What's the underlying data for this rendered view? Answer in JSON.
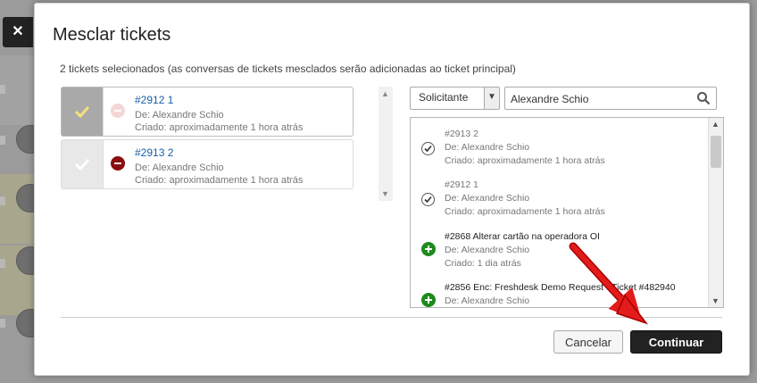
{
  "modal": {
    "close_icon": "close-icon",
    "title": "Mesclar tickets",
    "subtitle": "2 tickets selecionados (as conversas de tickets mesclados serão adicionadas ao ticket principal)"
  },
  "selected": [
    {
      "number": "#2912 1",
      "from": "De: Alexandre Schio",
      "created": "Criado: aproximadamente 1 hora atrás",
      "primary": true
    },
    {
      "number": "#2913 2",
      "from": "De: Alexandre Schio",
      "created": "Criado: aproximadamente 1 hora atrás",
      "primary": false
    }
  ],
  "search": {
    "filter_value": "Solicitante",
    "query": "Alexandre Schio"
  },
  "results": [
    {
      "title": "#2913 2",
      "from": "De: Alexandre Schio",
      "created": "Criado: aproximadamente 1 hora atrás",
      "state": "selected"
    },
    {
      "title": "#2912 1",
      "from": "De: Alexandre Schio",
      "created": "Criado: aproximadamente 1 hora atrás",
      "state": "selected"
    },
    {
      "title": "#2868 Alterar cartão na operadora OI",
      "from": "De: Alexandre Schio",
      "created": "Criado: 1 dia atrás",
      "state": "add"
    },
    {
      "title": "#2856 Enc: Freshdesk Demo Request - Ticket #482940",
      "from": "De: Alexandre Schio",
      "created": "",
      "state": "add"
    }
  ],
  "buttons": {
    "cancel": "Cancelar",
    "continue": "Continuar"
  },
  "colors": {
    "continue_bg": "#222222",
    "link": "#1a5ea8",
    "add_icon": "#1e8a1e",
    "remove_icon": "#8b0d0d",
    "annotation_arrow": "#e21b1b"
  }
}
